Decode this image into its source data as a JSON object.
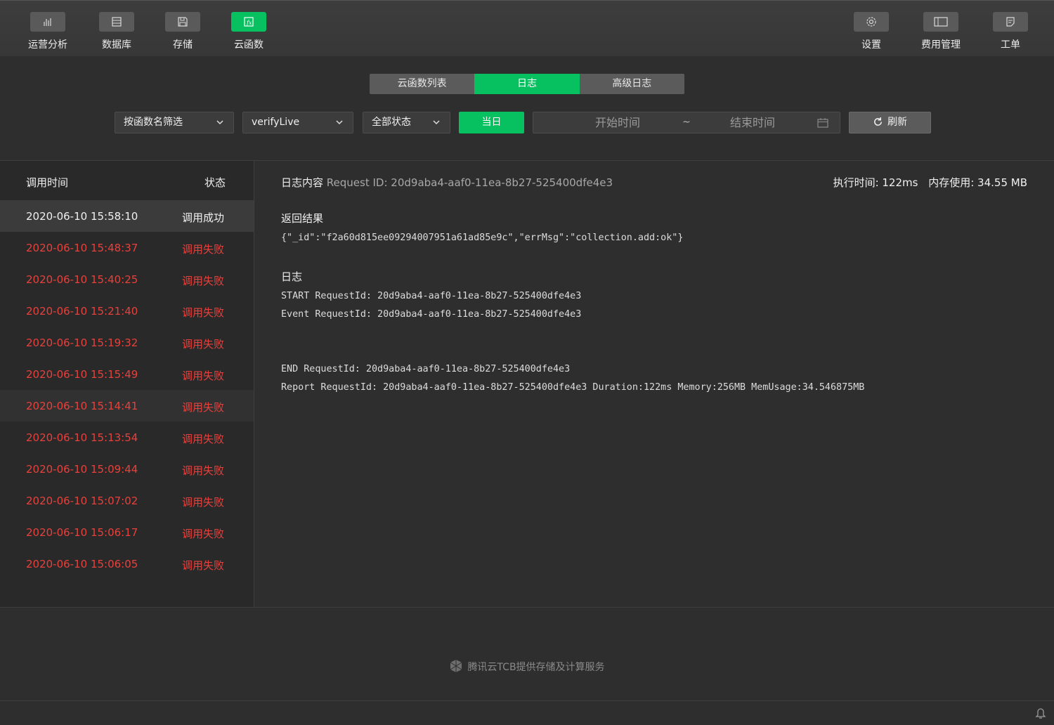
{
  "toolbar": {
    "left": [
      {
        "label": "运营分析",
        "icon": "bar-chart-icon"
      },
      {
        "label": "数据库",
        "icon": "database-icon"
      },
      {
        "label": "存储",
        "icon": "floppy-disk-icon"
      },
      {
        "label": "云函数",
        "icon": "function-icon",
        "active": true
      }
    ],
    "right": [
      {
        "label": "设置",
        "icon": "gear-icon"
      },
      {
        "label": "费用管理",
        "icon": "billing-icon"
      },
      {
        "label": "工单",
        "icon": "ticket-icon"
      }
    ]
  },
  "tabs": [
    {
      "label": "云函数列表"
    },
    {
      "label": "日志",
      "active": true
    },
    {
      "label": "高级日志"
    }
  ],
  "filters": {
    "function_select": "按函数名筛选",
    "name_select": "verifyLive",
    "status_select": "全部状态",
    "today_label": "当日",
    "start_placeholder": "开始时间",
    "separator": "~",
    "end_placeholder": "结束时间",
    "refresh_label": "刷新"
  },
  "list": {
    "header_time": "调用时间",
    "header_status": "状态",
    "rows": [
      {
        "time": "2020-06-10 15:58:10",
        "status": "调用成功",
        "ok": true
      },
      {
        "time": "2020-06-10 15:48:37",
        "status": "调用失败",
        "ok": false
      },
      {
        "time": "2020-06-10 15:40:25",
        "status": "调用失败",
        "ok": false
      },
      {
        "time": "2020-06-10 15:21:40",
        "status": "调用失败",
        "ok": false
      },
      {
        "time": "2020-06-10 15:19:32",
        "status": "调用失败",
        "ok": false
      },
      {
        "time": "2020-06-10 15:15:49",
        "status": "调用失败",
        "ok": false
      },
      {
        "time": "2020-06-10 15:14:41",
        "status": "调用失败",
        "ok": false
      },
      {
        "time": "2020-06-10 15:13:54",
        "status": "调用失败",
        "ok": false
      },
      {
        "time": "2020-06-10 15:09:44",
        "status": "调用失败",
        "ok": false
      },
      {
        "time": "2020-06-10 15:07:02",
        "status": "调用失败",
        "ok": false
      },
      {
        "time": "2020-06-10 15:06:17",
        "status": "调用失败",
        "ok": false
      },
      {
        "time": "2020-06-10 15:06:05",
        "status": "调用失败",
        "ok": false
      }
    ]
  },
  "detail": {
    "title": "日志内容",
    "request_id": "Request ID: 20d9aba4-aaf0-11ea-8b27-525400dfe4e3",
    "exec_time": "执行时间: 122ms",
    "memory": "内存使用: 34.55 MB",
    "result_title": "返回结果",
    "result": "{\"_id\":\"f2a60d815ee09294007951a61ad85e9c\",\"errMsg\":\"collection.add:ok\"}",
    "log_title": "日志",
    "log_lines": [
      "START RequestId: 20d9aba4-aaf0-11ea-8b27-525400dfe4e3",
      "Event RequestId: 20d9aba4-aaf0-11ea-8b27-525400dfe4e3",
      "END RequestId: 20d9aba4-aaf0-11ea-8b27-525400dfe4e3",
      "Report RequestId: 20d9aba4-aaf0-11ea-8b27-525400dfe4e3 Duration:122ms Memory:256MB MemUsage:34.546875MB"
    ]
  },
  "footer": {
    "text": "腾讯云TCB提供存储及计算服务"
  },
  "colors": {
    "accent": "#07c160",
    "error": "#e8413c"
  }
}
